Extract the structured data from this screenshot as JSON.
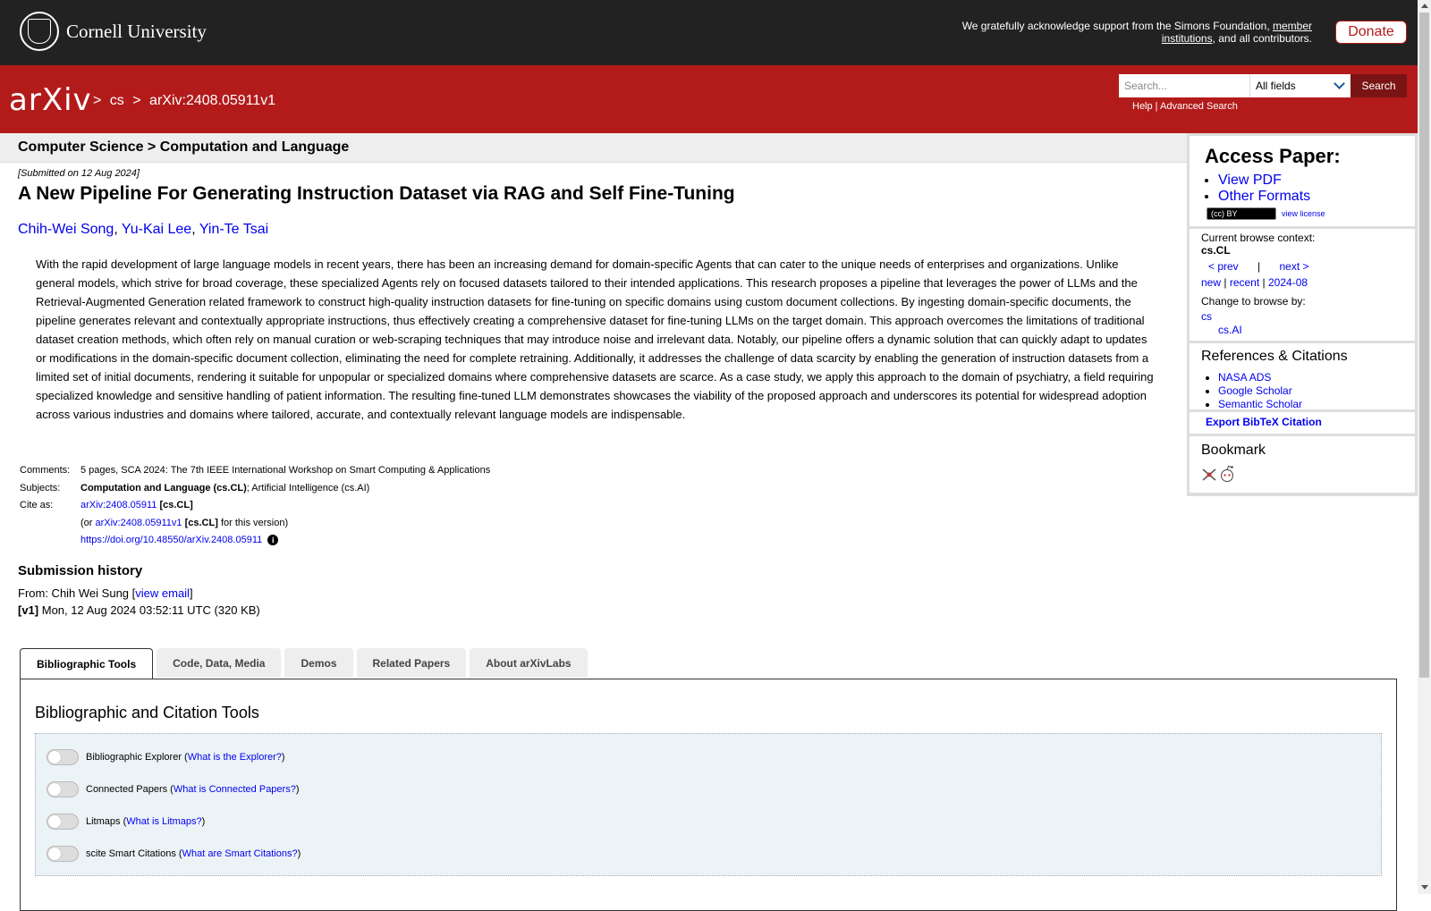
{
  "header": {
    "institution": "Cornell University",
    "ack_text": "We gratefully acknowledge support from the Simons Foundation, ",
    "ack_link": "member institutions",
    "ack_suffix": ", and all contributors.",
    "donate_label": "Donate"
  },
  "nav": {
    "logo": "arXiv",
    "crumb_sep1": ">",
    "crumb_cs": "cs",
    "crumb_sep2": ">",
    "crumb_id": "arXiv:2408.05911v1",
    "search_placeholder": "Search...",
    "search_field": "All fields",
    "search_button": "Search",
    "help": "Help",
    "help_sep": " | ",
    "advanced": "Advanced Search"
  },
  "subheader": "Computer Science > Computation and Language",
  "paper": {
    "submitted": "[Submitted on 12 Aug 2024]",
    "title": "A New Pipeline For Generating Instruction Dataset via RAG and Self Fine-Tuning",
    "authors": [
      "Chih-Wei Song",
      "Yu-Kai Lee",
      "Yin-Te Tsai"
    ],
    "abstract": "With the rapid development of large language models in recent years, there has been an increasing demand for domain-specific Agents that can cater to the unique needs of enterprises and organizations. Unlike general models, which strive for broad coverage, these specialized Agents rely on focused datasets tailored to their intended applications. This research proposes a pipeline that leverages the power of LLMs and the Retrieval-Augmented Generation related framework to construct high-quality instruction datasets for fine-tuning on specific domains using custom document collections. By ingesting domain-specific documents, the pipeline generates relevant and contextually appropriate instructions, thus effectively creating a comprehensive dataset for fine-tuning LLMs on the target domain. This approach overcomes the limitations of traditional dataset creation methods, which often rely on manual curation or web-scraping techniques that may introduce noise and irrelevant data. Notably, our pipeline offers a dynamic solution that can quickly adapt to updates or modifications in the domain-specific document collection, eliminating the need for complete retraining. Additionally, it addresses the challenge of data scarcity by enabling the generation of instruction datasets from a limited set of initial documents, rendering it suitable for unpopular or specialized domains where comprehensive datasets are scarce. As a case study, we apply this approach to the domain of psychiatry, a field requiring specialized knowledge and sensitive handling of patient information. The resulting fine-tuned LLM demonstrates showcases the viability of the proposed approach and underscores its potential for widespread adoption across various industries and domains where tailored, accurate, and contextually relevant language models are indispensable.",
    "comments_label": "Comments:",
    "comments": "5 pages, SCA 2024: The 7th IEEE International Workshop on Smart Computing & Applications",
    "subjects_label": "Subjects:",
    "subjects_primary": "Computation and Language (cs.CL)",
    "subjects_rest": "; Artificial Intelligence (cs.AI)",
    "cite_label": "Cite as:",
    "cite_id": "arXiv:2408.05911",
    "cite_cat": " [cs.CL]",
    "cite_or": "(or ",
    "cite_vid": "arXiv:2408.05911v1",
    "cite_vcat": " [cs.CL]",
    "cite_vsuffix": " for this version)",
    "doi": "https://doi.org/10.48550/arXiv.2408.05911",
    "info_glyph": "i"
  },
  "history": {
    "heading": "Submission history",
    "from": "From: Chih Wei Sung [",
    "view_email": "view email",
    "from_close": "]",
    "v1_label": "[v1]",
    "v1_text": " Mon, 12 Aug 2024 03:52:11 UTC (320 KB)"
  },
  "tabs": [
    "Bibliographic Tools",
    "Code, Data, Media",
    "Demos",
    "Related Papers",
    "About arXivLabs"
  ],
  "panel": {
    "title": "Bibliographic and Citation Tools",
    "tools": [
      {
        "name": "Bibliographic Explorer",
        "link": "What is the Explorer?"
      },
      {
        "name": "Connected Papers",
        "link": "What is Connected Papers?"
      },
      {
        "name": "Litmaps",
        "link": "What is Litmaps?"
      },
      {
        "name": "scite Smart Citations",
        "link": "What are Smart Citations?"
      }
    ]
  },
  "sidebar": {
    "access_heading": "Access Paper:",
    "view_pdf": "View PDF",
    "other_formats": "Other Formats",
    "cc_badge": "(cc) BY",
    "view_license": "view license",
    "browse_context_label": "Current browse context:",
    "browse_context": "cs.CL",
    "prev": "< prev",
    "pipe": "|",
    "next": "next >",
    "new": "new",
    "recent": "recent",
    "month": "2024-08",
    "change_label": "Change to browse by:",
    "cs": "cs",
    "csai": "cs.AI",
    "refs_heading": "References & Citations",
    "refs": [
      "NASA ADS",
      "Google Scholar",
      "Semantic Scholar"
    ],
    "export": "Export BibTeX Citation",
    "bookmark": "Bookmark"
  }
}
